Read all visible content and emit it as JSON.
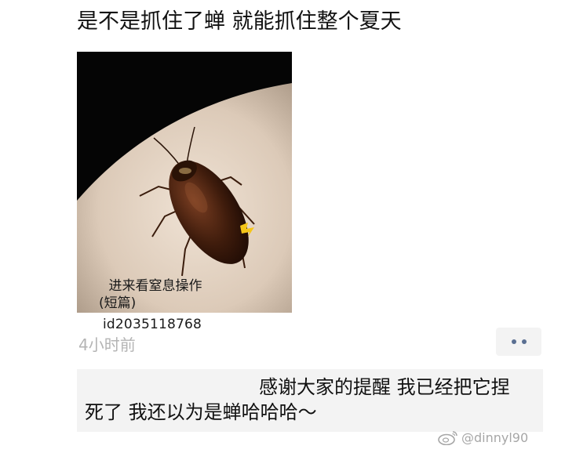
{
  "post": {
    "text": "是不是抓住了蝉 就能抓住整个夏天",
    "image_caption_line1": "进来看窒息操作",
    "image_caption_line2": "(短篇)",
    "image_id_text": "id2035118768",
    "timestamp": "4小时前"
  },
  "comment": {
    "line1": "感谢大家的提醒 我已经把它捏",
    "line2": "死了 我还以为是蝉哈哈哈～"
  },
  "watermark": {
    "handle": "@dinnyl90"
  },
  "icons": {
    "more": "more-dots-icon",
    "weibo": "weibo-logo-icon"
  },
  "colors": {
    "timestamp": "#b4b4b4",
    "comment_bg": "#f3f3f3",
    "more_dots": "#5a6f92"
  }
}
